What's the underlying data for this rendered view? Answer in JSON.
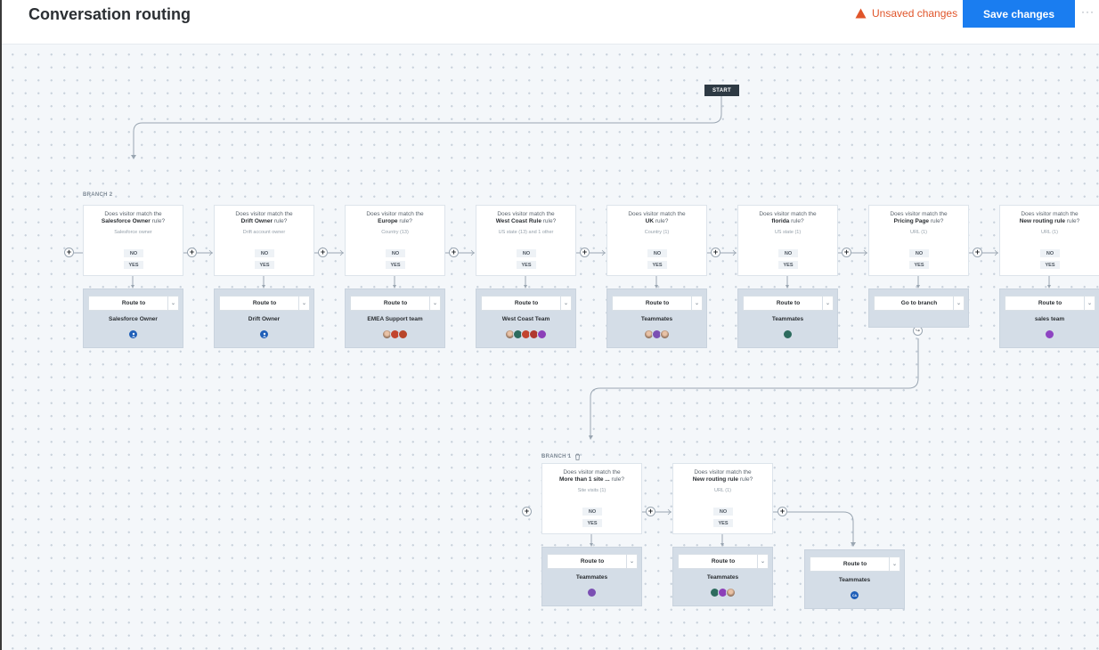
{
  "header": {
    "title": "Conversation routing",
    "warning": "Unsaved changes",
    "save_label": "Save changes",
    "more": "···"
  },
  "canvas": {
    "start_label": "START",
    "branch2_label": "BRANCH 2",
    "branch1_label": "BRANCH 1",
    "question_prefix": "Does visitor match the",
    "question_suffix": "rule?",
    "no_label": "NO",
    "yes_label": "YES",
    "route_to": "Route to",
    "go_to_branch": "Go to branch"
  },
  "rules": [
    {
      "name": "Salesforce Owner",
      "condition": "Salesforce owner",
      "action": "Route to",
      "target": "Salesforce Owner",
      "avatars": [
        "user-icon"
      ]
    },
    {
      "name": "Drift Owner",
      "condition": "Drift account owner",
      "action": "Route to",
      "target": "Drift Owner",
      "avatars": [
        "user-icon"
      ]
    },
    {
      "name": "Europe",
      "condition": "Country (13)",
      "action": "Route to",
      "target": "EMEA Support team",
      "avatars": [
        "photo",
        "BD",
        "OB"
      ]
    },
    {
      "name": "West Coast Rule",
      "condition": "US state (13) and 1 other",
      "action": "Route to",
      "target": "West Coast Team",
      "avatars": [
        "photo",
        "CL",
        "AS",
        "RH",
        "MN"
      ]
    },
    {
      "name": "UK",
      "condition": "Country (1)",
      "action": "Route to",
      "target": "Teammates",
      "avatars": [
        "photo",
        "BH",
        "photo"
      ]
    },
    {
      "name": "florida",
      "condition": "US state (1)",
      "action": "Route to",
      "target": "Teammates",
      "avatars": [
        "CL"
      ]
    },
    {
      "name": "Pricing Page",
      "condition": "URL (1)",
      "action": "Go to branch",
      "target": "",
      "avatars": []
    },
    {
      "name": "New routing rule",
      "condition": "URL (1)",
      "action": "Route to",
      "target": "sales team",
      "avatars": [
        "SC"
      ]
    }
  ],
  "branch1_rules": [
    {
      "name": "More than 1 site ...",
      "condition": "Site visits (1)",
      "action": "Route to",
      "target": "Teammates",
      "avatars": [
        "BH"
      ]
    },
    {
      "name": "New routing rule",
      "condition": "URL (1)",
      "action": "Route to",
      "target": "Teammates",
      "avatars": [
        "CL",
        "AM",
        "photo"
      ]
    }
  ],
  "fallback": {
    "action": "Route to",
    "target": "Teammates",
    "avatars": [
      "CA"
    ]
  },
  "colors": {
    "accent": "#1a7df0",
    "warning": "#e0552a",
    "route_bg": "#d4dde7"
  }
}
